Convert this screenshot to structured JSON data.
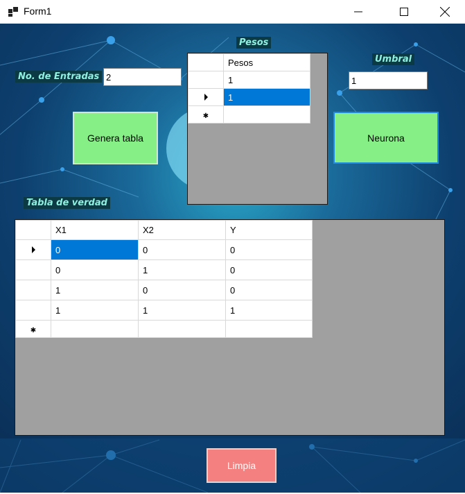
{
  "window": {
    "title": "Form1"
  },
  "labels": {
    "entradas": "No. de Entradas",
    "pesos": "Pesos",
    "umbral": "Umbral",
    "tabla": "Tabla de verdad"
  },
  "inputs": {
    "entradas_value": "2",
    "umbral_value": "1"
  },
  "buttons": {
    "genera": "Genera tabla",
    "neurona": "Neurona",
    "limpia": "Limpia"
  },
  "pesos_grid": {
    "header": "Pesos",
    "rows": [
      "1",
      "1"
    ]
  },
  "truth_grid": {
    "columns": [
      "X1",
      "X2",
      "Y"
    ],
    "rows": [
      [
        "0",
        "0",
        "0"
      ],
      [
        "0",
        "1",
        "0"
      ],
      [
        "1",
        "0",
        "0"
      ],
      [
        "1",
        "1",
        "1"
      ]
    ]
  },
  "icons": [
    "app-icon",
    "minimize-icon",
    "maximize-icon",
    "close-icon",
    "row-selector-arrow-icon",
    "new-row-star-icon"
  ],
  "colors": {
    "button_green": "#86f086",
    "button_pink": "#f58080",
    "selection_blue": "#0078d7",
    "grid_bg": "#a0a0a0"
  }
}
